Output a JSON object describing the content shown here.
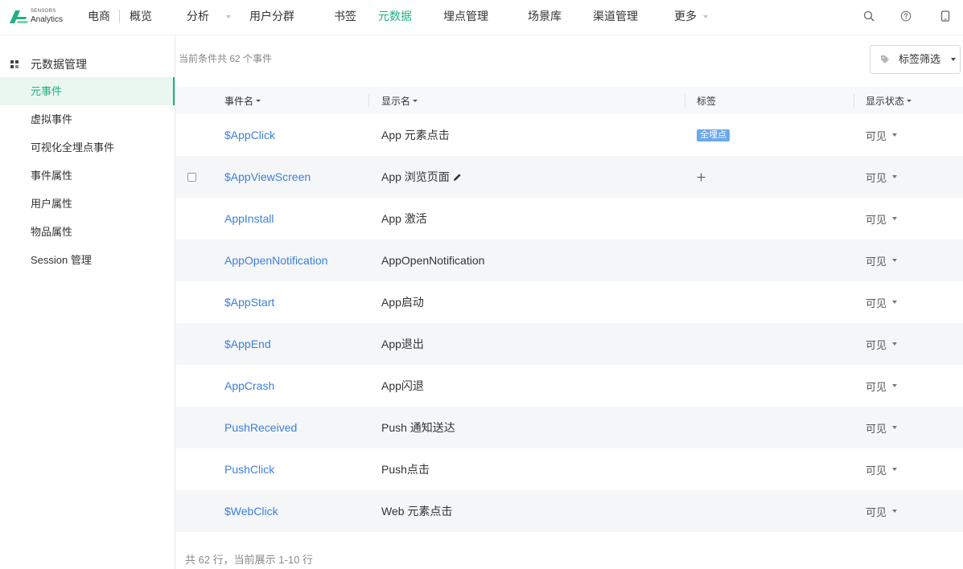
{
  "logo": {
    "line1": "SENSORS",
    "line2": "Analytics",
    "icon": "sensors-logo-icon"
  },
  "nav": {
    "project": "电商",
    "items": [
      {
        "label": "概览"
      },
      {
        "label": "分析",
        "has_dropdown": true
      },
      {
        "label": "用户分群"
      },
      {
        "label": "书签"
      },
      {
        "label": "元数据",
        "active": true
      },
      {
        "label": "埋点管理"
      },
      {
        "label": "场景库"
      },
      {
        "label": "渠道管理"
      },
      {
        "label": "更多",
        "has_dropdown": true
      }
    ],
    "right_icons": [
      "search-icon",
      "question-circle-icon",
      "device-icon"
    ]
  },
  "sidebar": {
    "title": "元数据管理",
    "title_icon": "grid-icon",
    "items": [
      {
        "label": "元事件",
        "active": true
      },
      {
        "label": "虚拟事件"
      },
      {
        "label": "可视化全埋点事件"
      },
      {
        "label": "事件属性"
      },
      {
        "label": "用户属性"
      },
      {
        "label": "物品属性"
      },
      {
        "label": "Session 管理"
      }
    ]
  },
  "main": {
    "summary": "当前条件共 62 个事件",
    "tag_filter": {
      "label": "标签筛选",
      "icon": "tag-icon"
    },
    "columns": [
      {
        "label": "事件名",
        "sortable": true
      },
      {
        "label": "显示名",
        "sortable": true
      },
      {
        "label": "标签",
        "sortable": false
      },
      {
        "label": "显示状态",
        "sortable": true
      }
    ],
    "rows": [
      {
        "event": "$AppClick",
        "display": "App 元素点击",
        "tags": [
          "全埋点"
        ],
        "status": "可见"
      },
      {
        "event": "$AppViewScreen",
        "display": "App 浏览页面",
        "tags": [],
        "status": "可见"
      },
      {
        "event": "AppInstall",
        "display": "App 激活",
        "tags": [],
        "status": "可见"
      },
      {
        "event": "AppOpenNotification",
        "display": "AppOpenNotification",
        "tags": [],
        "status": "可见"
      },
      {
        "event": "$AppStart",
        "display": "App启动",
        "tags": [],
        "status": "可见"
      },
      {
        "event": "$AppEnd",
        "display": "App退出",
        "tags": [],
        "status": "可见"
      },
      {
        "event": "AppCrash",
        "display": "App闪退",
        "tags": [],
        "status": "可见"
      },
      {
        "event": "PushReceived",
        "display": "Push 通知送达",
        "tags": [],
        "status": "可见"
      },
      {
        "event": "PushClick",
        "display": "Push点击",
        "tags": [],
        "status": "可见"
      },
      {
        "event": "$WebClick",
        "display": "Web 元素点击",
        "tags": [],
        "status": "可见"
      }
    ],
    "footer": "共 62 行，当前展示 1-10 行"
  },
  "colors": {
    "accent": "#20b27c",
    "link": "#3b7fe0",
    "tag_background": "#6ba8ec"
  }
}
